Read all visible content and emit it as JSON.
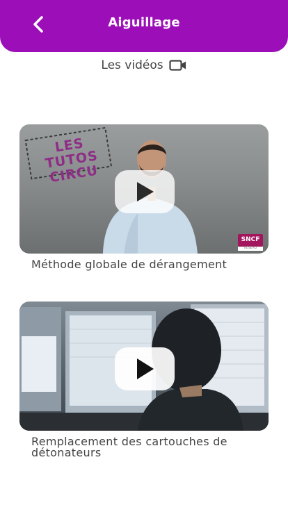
{
  "header": {
    "title": "Aiguillage",
    "back_icon": "chevron-left-icon",
    "background_color": "#9c0fb8"
  },
  "section": {
    "label": "Les vidéos",
    "icon": "video-camera-icon"
  },
  "videos": [
    {
      "title": "Méthode globale de dérangement",
      "thumbnail_text": "LES TUTOS CIRCU",
      "logo_text": "SNCF",
      "logo_subtext": "RÉSEAU"
    },
    {
      "title": "Remplacement des cartouches de détonateurs"
    }
  ]
}
